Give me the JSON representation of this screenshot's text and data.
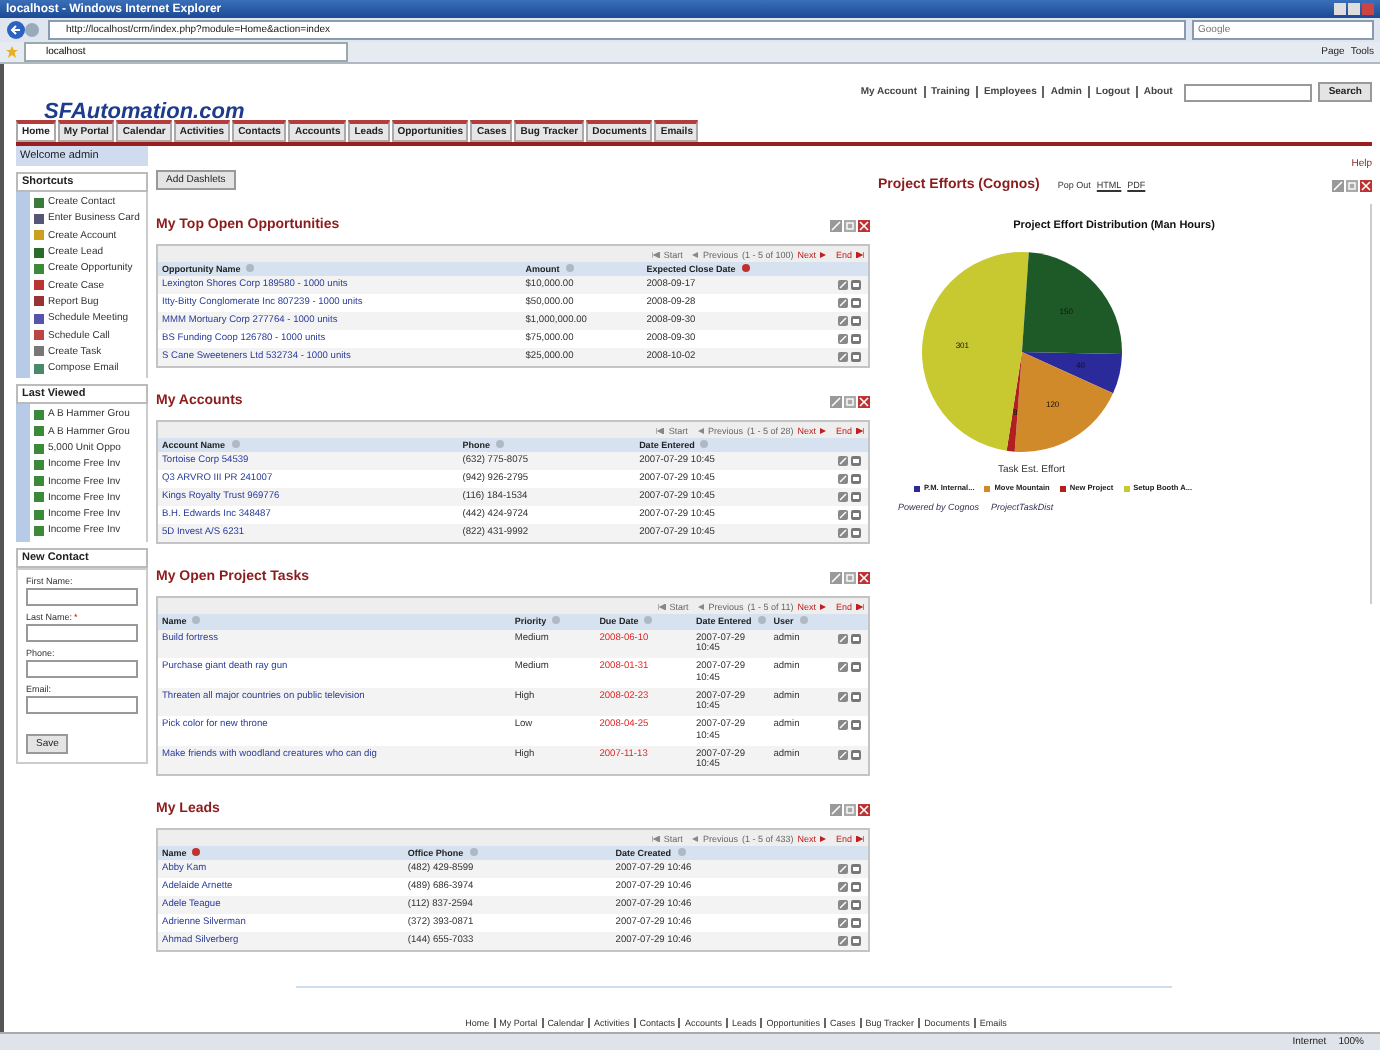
{
  "browser": {
    "title": "localhost - Windows Internet Explorer",
    "url": "http://localhost/crm/index.php?module=Home&action=index",
    "search_placeholder": "Google",
    "tab": "localhost",
    "commands": [
      "Page",
      "Tools"
    ],
    "status_zone": "Internet",
    "zoom": "100%"
  },
  "header": {
    "logo": "SFAutomation.com",
    "top_links": [
      "My Account",
      "Training",
      "Employees",
      "Admin",
      "Logout",
      "About"
    ],
    "search_button": "Search"
  },
  "tabs": [
    {
      "label": "Home",
      "selected": true
    },
    {
      "label": "My Portal",
      "selected": false
    },
    {
      "label": "Calendar",
      "selected": false
    },
    {
      "label": "Activities",
      "selected": false
    },
    {
      "label": "Contacts",
      "selected": false
    },
    {
      "label": "Accounts",
      "selected": false
    },
    {
      "label": "Leads",
      "selected": false
    },
    {
      "label": "Opportunities",
      "selected": false
    },
    {
      "label": "Cases",
      "selected": false
    },
    {
      "label": "Bug Tracker",
      "selected": false
    },
    {
      "label": "Documents",
      "selected": false
    },
    {
      "label": "Emails",
      "selected": false
    }
  ],
  "sidebar": {
    "welcome": "Welcome admin",
    "shortcuts": {
      "title": "Shortcuts",
      "items": [
        "Create Contact",
        "Enter Business Card",
        "Create Account",
        "Create Lead",
        "Create Opportunity",
        "Create Case",
        "Report Bug",
        "Schedule Meeting",
        "Schedule Call",
        "Create Task",
        "Compose Email"
      ]
    },
    "last_viewed": {
      "title": "Last Viewed",
      "items": [
        "A B Hammer Grou",
        "A B Hammer Grou",
        "5,000 Unit Oppo",
        "Income Free Inv",
        "Income Free Inv",
        "Income Free Inv",
        "Income Free Inv",
        "Income Free Inv"
      ]
    },
    "new_contact": {
      "title": "New Contact",
      "fields": [
        {
          "label": "First Name:",
          "required": false
        },
        {
          "label": "Last Name:",
          "required": true
        },
        {
          "label": "Phone:",
          "required": false
        },
        {
          "label": "Email:",
          "required": false
        }
      ],
      "button": "Save",
      "required_mark": "*"
    }
  },
  "add_dashlets": "Add Dashlets",
  "help": "Help",
  "dashlets": [
    {
      "title": "My Top Open Opportunities",
      "pager": {
        "start": "Start",
        "previous": "Previous",
        "range": "(1 - 5 of 100)",
        "next": "Next",
        "end": "End"
      },
      "columns": [
        {
          "label": "Opportunity Name",
          "sorted": false,
          "kind": "link"
        },
        {
          "label": "Amount",
          "sorted": false,
          "kind": "text"
        },
        {
          "label": "Expected Close Date",
          "sorted": true,
          "kind": "text"
        }
      ],
      "rows": [
        [
          "Lexington Shores Corp 189580 - 1000 units",
          "$10,000.00",
          "2008-09-17"
        ],
        [
          "Itty-Bitty Conglomerate Inc 807239 - 1000 units",
          "$50,000.00",
          "2008-09-28"
        ],
        [
          "MMM Mortuary Corp 277764 - 1000 units",
          "$1,000,000.00",
          "2008-09-30"
        ],
        [
          "BS Funding Coop 126780 - 1000 units",
          "$75,000.00",
          "2008-09-30"
        ],
        [
          "S Cane Sweeteners Ltd 532734 - 1000 units",
          "$25,000.00",
          "2008-10-02"
        ]
      ]
    },
    {
      "title": "My Accounts",
      "pager": {
        "start": "Start",
        "previous": "Previous",
        "range": "(1 - 5 of 28)",
        "next": "Next",
        "end": "End"
      },
      "columns": [
        {
          "label": "Account Name",
          "sorted": false,
          "kind": "link"
        },
        {
          "label": "Phone",
          "sorted": false,
          "kind": "text"
        },
        {
          "label": "Date Entered",
          "sorted": false,
          "kind": "text"
        }
      ],
      "rows": [
        [
          "Tortoise Corp 54539",
          "(632) 775-8075",
          "2007-07-29 10:45"
        ],
        [
          "Q3 ARVRO III PR 241007",
          "(942) 926-2795",
          "2007-07-29 10:45"
        ],
        [
          "Kings Royalty Trust 969776",
          "(116) 184-1534",
          "2007-07-29 10:45"
        ],
        [
          "B.H. Edwards Inc 348487",
          "(442) 424-9724",
          "2007-07-29 10:45"
        ],
        [
          "5D Invest A/S 6231",
          "(822) 431-9992",
          "2007-07-29 10:45"
        ]
      ]
    },
    {
      "title": "My Open Project Tasks",
      "pager": {
        "start": "Start",
        "previous": "Previous",
        "range": "(1 - 5 of 11)",
        "next": "Next",
        "end": "End"
      },
      "columns": [
        {
          "label": "Name",
          "sorted": false,
          "kind": "link"
        },
        {
          "label": "Priority",
          "sorted": false,
          "kind": "text"
        },
        {
          "label": "Due Date",
          "sorted": false,
          "kind": "overdue"
        },
        {
          "label": "Date Entered",
          "sorted": false,
          "kind": "narrow"
        },
        {
          "label": "User",
          "sorted": false,
          "kind": "text"
        }
      ],
      "rows": [
        [
          "Build fortress",
          "Medium",
          "2008-06-10",
          "2007-07-29 10:45",
          "admin"
        ],
        [
          "Purchase giant death ray gun",
          "Medium",
          "2008-01-31",
          "2007-07-29 10:45",
          "admin"
        ],
        [
          "Threaten all major countries on public television",
          "High",
          "2008-02-23",
          "2007-07-29 10:45",
          "admin"
        ],
        [
          "Pick color for new throne",
          "Low",
          "2008-04-25",
          "2007-07-29 10:45",
          "admin"
        ],
        [
          "Make friends with woodland creatures who can dig",
          "High",
          "2007-11-13",
          "2007-07-29 10:45",
          "admin"
        ]
      ]
    },
    {
      "title": "My Leads",
      "pager": {
        "start": "Start",
        "previous": "Previous",
        "range": "(1 - 5 of 433)",
        "next": "Next",
        "end": "End"
      },
      "columns": [
        {
          "label": "Name",
          "sorted": true,
          "kind": "link"
        },
        {
          "label": "Office Phone",
          "sorted": false,
          "kind": "text"
        },
        {
          "label": "Date Created",
          "sorted": false,
          "kind": "text"
        }
      ],
      "rows": [
        [
          "Abby Kam",
          "(482) 429-8599",
          "2007-07-29 10:46"
        ],
        [
          "Adelaide Arnette",
          "(489) 686-3974",
          "2007-07-29 10:46"
        ],
        [
          "Adele Teague",
          "(112) 837-2594",
          "2007-07-29 10:46"
        ],
        [
          "Adrienne Silverman",
          "(372) 393-0871",
          "2007-07-29 10:46"
        ],
        [
          "Ahmad Silverberg",
          "(144) 655-7033",
          "2007-07-29 10:46"
        ]
      ]
    }
  ],
  "chart_panel": {
    "title": "Project Efforts (Cognos)",
    "pop_out": "Pop Out",
    "links": [
      "HTML",
      "PDF"
    ],
    "chart_data": {
      "type": "pie",
      "title": "Project Effort Distribution (Man Hours)",
      "xlabel": "Task Est. Effort",
      "categories": [
        "P.M. Internal...",
        "Move Mountain",
        "New Project",
        "Setup Booth A...",
        null
      ],
      "values": [
        40,
        120,
        8,
        301,
        150
      ],
      "colors": [
        "#2a2a9a",
        "#d08a2a",
        "#b02020",
        "#c8c830",
        "#1e5a28"
      ],
      "data_labels": true
    },
    "powered_by": "Powered by Cognos",
    "report_name": "ProjectTaskDist"
  },
  "footer_links": [
    "Home",
    "My Portal",
    "Calendar",
    "Activities",
    "Contacts",
    "Accounts",
    "Leads",
    "Opportunities",
    "Cases",
    "Bug Tracker",
    "Documents",
    "Emails"
  ]
}
